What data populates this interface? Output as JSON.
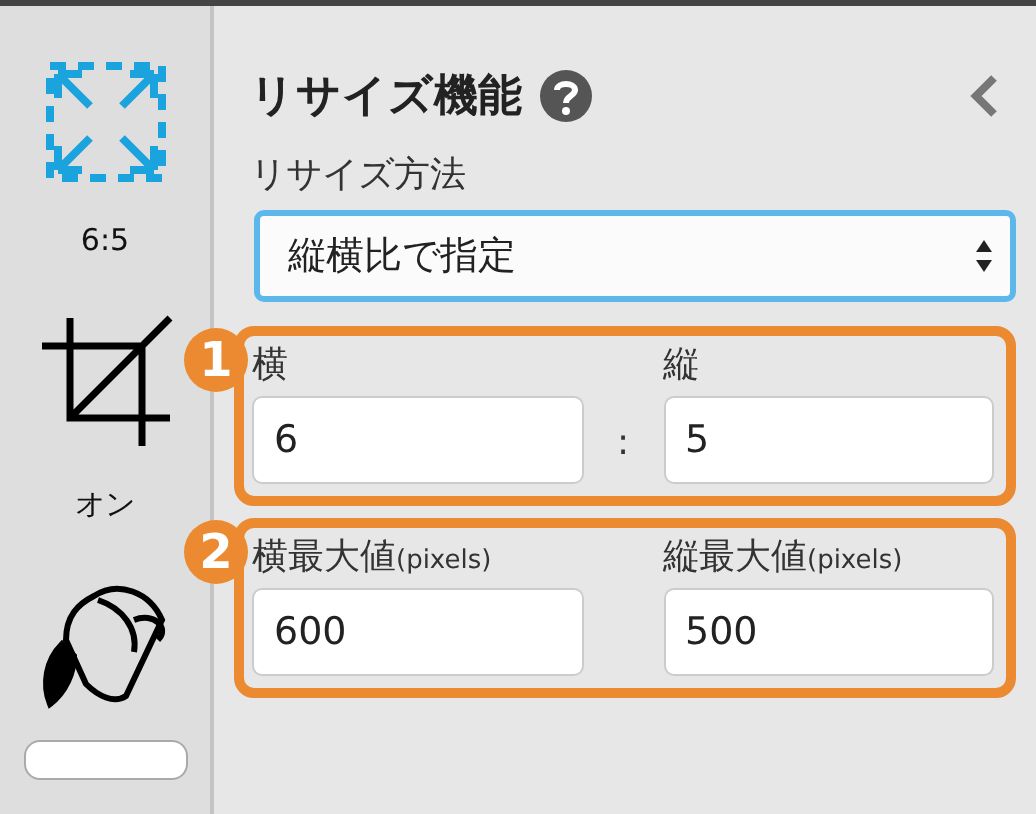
{
  "sidebar": {
    "tools": [
      {
        "kind": "resize",
        "label": "6:5"
      },
      {
        "kind": "crop",
        "label": "オン"
      },
      {
        "kind": "fill"
      }
    ]
  },
  "panel": {
    "title": "リサイズ機能",
    "method_label": "リサイズ方法",
    "method_value": "縦横比で指定",
    "groups": [
      {
        "badge": "1",
        "separator": ":",
        "fields": [
          {
            "label": "横",
            "value": "6"
          },
          {
            "label": "縦",
            "value": "5"
          }
        ]
      },
      {
        "badge": "2",
        "fields": [
          {
            "label": "横最大値",
            "unit": "(pixels)",
            "value": "600"
          },
          {
            "label": "縦最大値",
            "unit": "(pixels)",
            "value": "500"
          }
        ]
      }
    ]
  }
}
